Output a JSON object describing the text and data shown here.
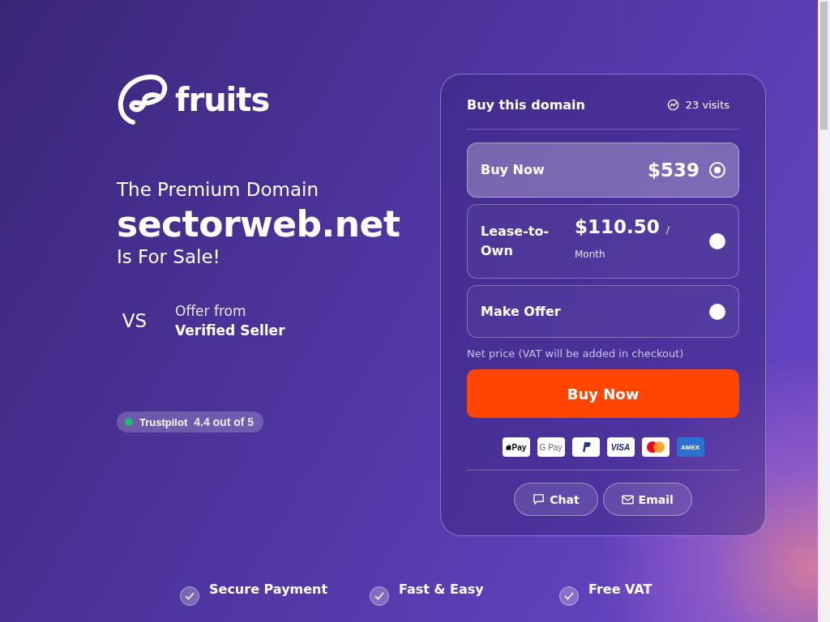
{
  "brand": {
    "name": "fruits"
  },
  "hero": {
    "eyebrow": "The Premium Domain",
    "domain": "sectorweb.net",
    "tagline": "Is For Sale!"
  },
  "seller": {
    "badge": "VS",
    "label": "Offer from",
    "name": "Verified Seller"
  },
  "rating": {
    "brand": "Trustpilot",
    "score": "4.4 out of 5"
  },
  "panel": {
    "title": "Buy this domain",
    "visits": "23 visits",
    "options": [
      {
        "label": "Buy Now",
        "price": "$539",
        "selected": true
      },
      {
        "label": "Lease-to-Own",
        "price": "$110.50",
        "separator": "/",
        "unit": "Month",
        "selected": false
      },
      {
        "label": "Make Offer",
        "selected": false
      }
    ],
    "note": "Net price (VAT will be added in checkout)",
    "cta": "Buy Now",
    "payment_methods": [
      {
        "kind": "applepay",
        "label": "Pay"
      },
      {
        "kind": "gpay",
        "label": "G Pay"
      },
      {
        "kind": "paypal"
      },
      {
        "kind": "visa",
        "label": "VISA"
      },
      {
        "kind": "mastercard"
      },
      {
        "kind": "amex",
        "label": "AMEX"
      }
    ],
    "contacts": [
      {
        "kind": "chat",
        "label": "Chat"
      },
      {
        "kind": "email",
        "label": "Email"
      }
    ]
  },
  "features": [
    {
      "label": "Secure Payment"
    },
    {
      "label": "Fast & Easy"
    },
    {
      "label": "Free VAT"
    }
  ]
}
